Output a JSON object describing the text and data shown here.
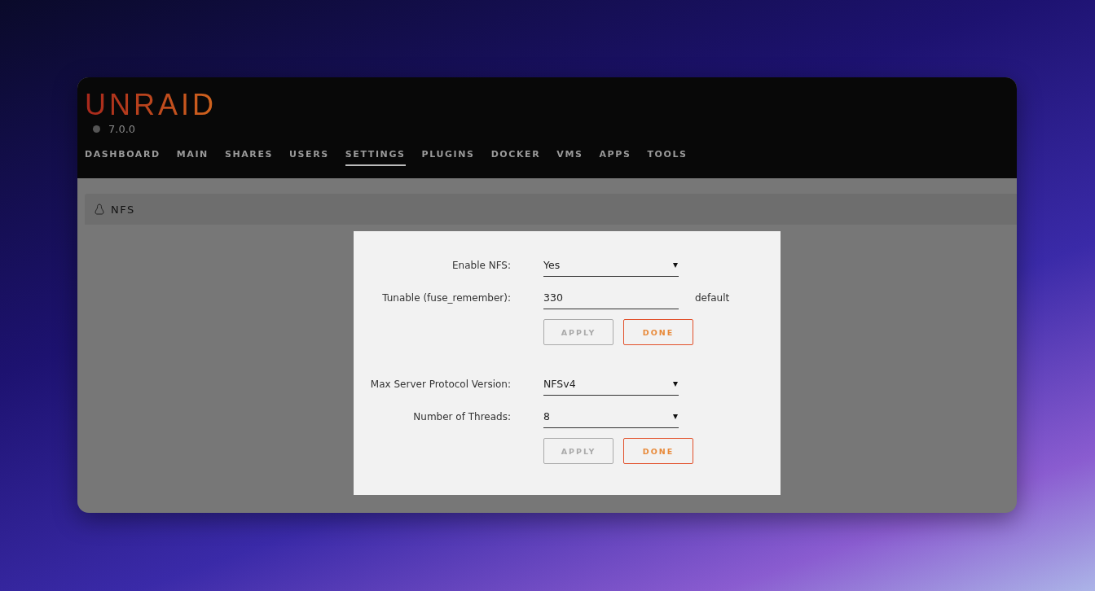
{
  "header": {
    "logo": "UNRAID",
    "version": "7.0.0"
  },
  "nav": [
    {
      "label": "DASHBOARD",
      "selected": false
    },
    {
      "label": "MAIN",
      "selected": false
    },
    {
      "label": "SHARES",
      "selected": false
    },
    {
      "label": "USERS",
      "selected": false
    },
    {
      "label": "SETTINGS",
      "selected": true
    },
    {
      "label": "PLUGINS",
      "selected": false
    },
    {
      "label": "DOCKER",
      "selected": false
    },
    {
      "label": "VMS",
      "selected": false
    },
    {
      "label": "APPS",
      "selected": false
    },
    {
      "label": "TOOLS",
      "selected": false
    }
  ],
  "section": {
    "title": "NFS"
  },
  "dialog": {
    "groups": [
      {
        "fields": [
          {
            "kind": "select",
            "label": "Enable NFS:",
            "value": "Yes"
          },
          {
            "kind": "input",
            "label": "Tunable (fuse_remember):",
            "value": "330",
            "note": "default"
          }
        ],
        "buttons": [
          {
            "label": "APPLY",
            "disabled": true
          },
          {
            "label": "DONE",
            "disabled": false
          }
        ]
      },
      {
        "fields": [
          {
            "kind": "select",
            "label": "Max Server Protocol Version:",
            "value": "NFSv4"
          },
          {
            "kind": "select",
            "label": "Number of Threads:",
            "value": "8"
          }
        ],
        "buttons": [
          {
            "label": "APPLY",
            "disabled": true
          },
          {
            "label": "DONE",
            "disabled": false
          }
        ]
      }
    ]
  }
}
